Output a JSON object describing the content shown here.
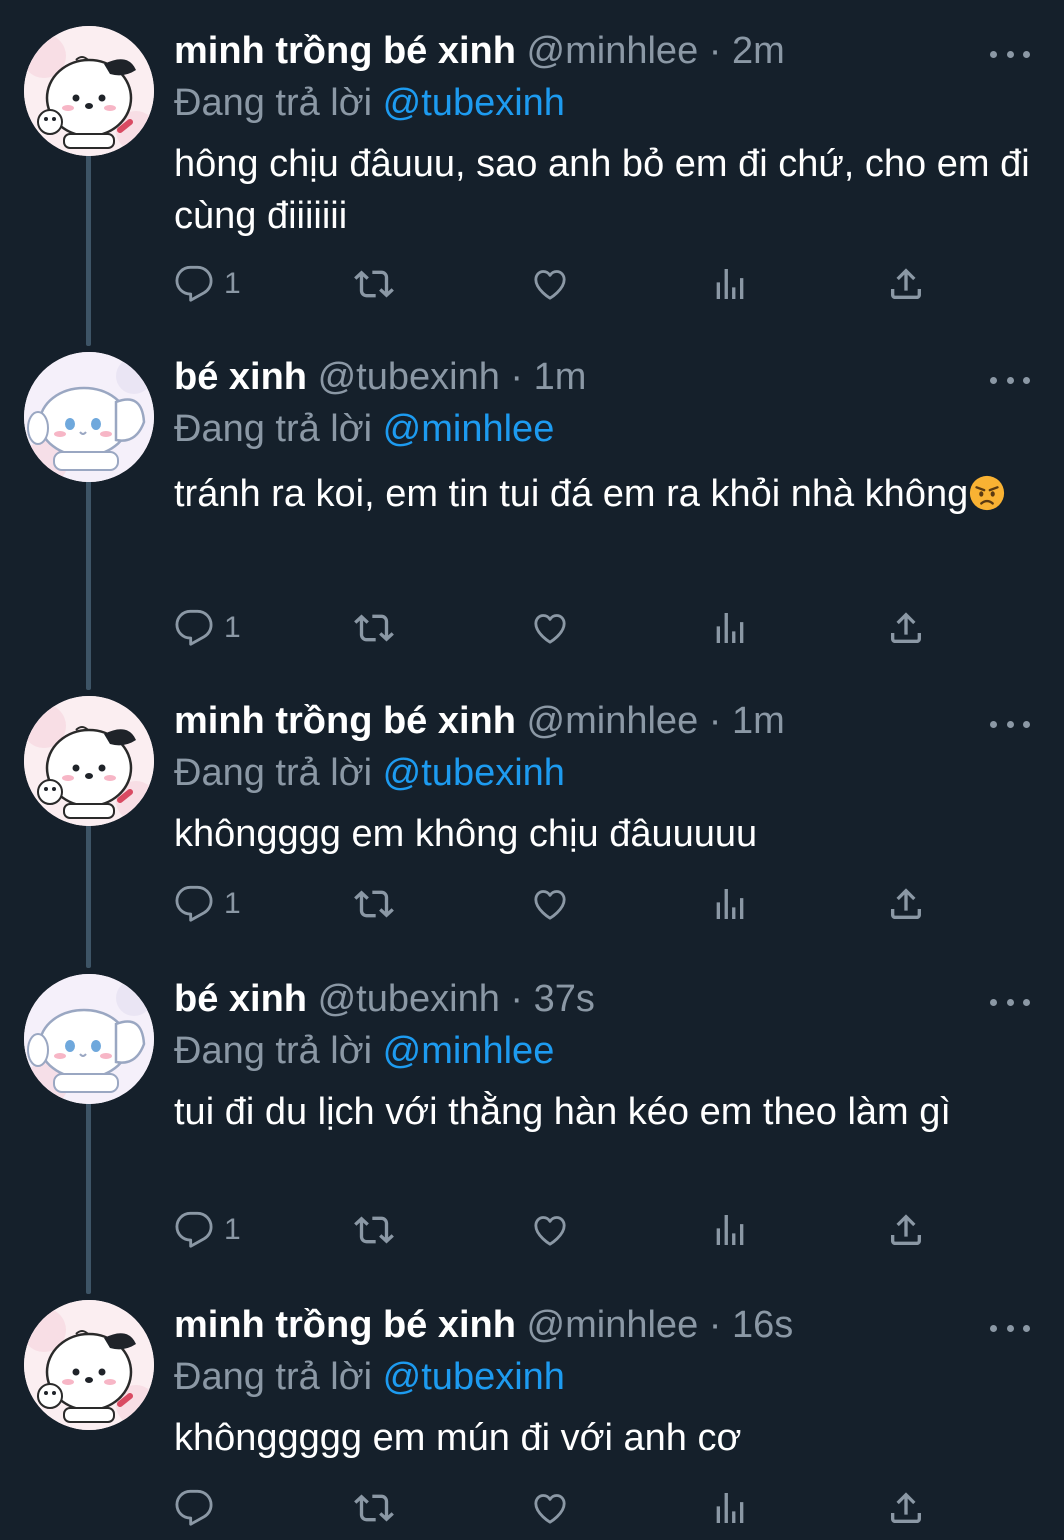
{
  "tweets": [
    {
      "name": "minh trồng bé xinh",
      "handle": "@minhlee",
      "sep": "·",
      "time": "2m",
      "replying_label": "Đang trả lời",
      "replying_to": "@tubexinh",
      "text": "hông chịu đâuuu, sao anh bỏ em đi chứ, cho em đi cùng điiiiiii",
      "emoji": "",
      "reply_count": "1",
      "avatar": "white-puppy-avatar"
    },
    {
      "name": "bé xinh",
      "handle": "@tubexinh",
      "sep": "·",
      "time": "1m",
      "replying_label": "Đang trả lời",
      "replying_to": "@minhlee",
      "text": "tránh ra koi, em tin tui đá em ra khỏi nhà không",
      "emoji": "angry-face",
      "reply_count": "1",
      "avatar": "white-bunny-avatar"
    },
    {
      "name": "minh trồng bé xinh",
      "handle": "@minhlee",
      "sep": "·",
      "time": "1m",
      "replying_label": "Đang trả lời",
      "replying_to": "@tubexinh",
      "text": "khôngggg em không chịu đâuuuuu",
      "emoji": "",
      "reply_count": "1",
      "avatar": "white-puppy-avatar"
    },
    {
      "name": "bé xinh",
      "handle": "@tubexinh",
      "sep": "·",
      "time": "37s",
      "replying_label": "Đang trả lời",
      "replying_to": "@minhlee",
      "text": "tui đi du lịch với thằng hàn kéo em theo làm gì",
      "emoji": "",
      "reply_count": "1",
      "avatar": "white-bunny-avatar"
    },
    {
      "name": "minh trồng bé xinh",
      "handle": "@minhlee",
      "sep": "·",
      "time": "16s",
      "replying_label": "Đang trả lời",
      "replying_to": "@tubexinh",
      "text": "khônggggg em mún đi với anh cơ",
      "emoji": "",
      "reply_count": "",
      "avatar": "white-puppy-avatar"
    }
  ],
  "colors": {
    "background": "#15202b",
    "text": "#ffffff",
    "muted": "#8b98a5",
    "accent": "#1d9bf0",
    "thread_line": "#3d5466"
  },
  "icons": [
    "reply-icon",
    "retweet-icon",
    "like-icon",
    "views-icon",
    "share-icon",
    "more-icon"
  ]
}
